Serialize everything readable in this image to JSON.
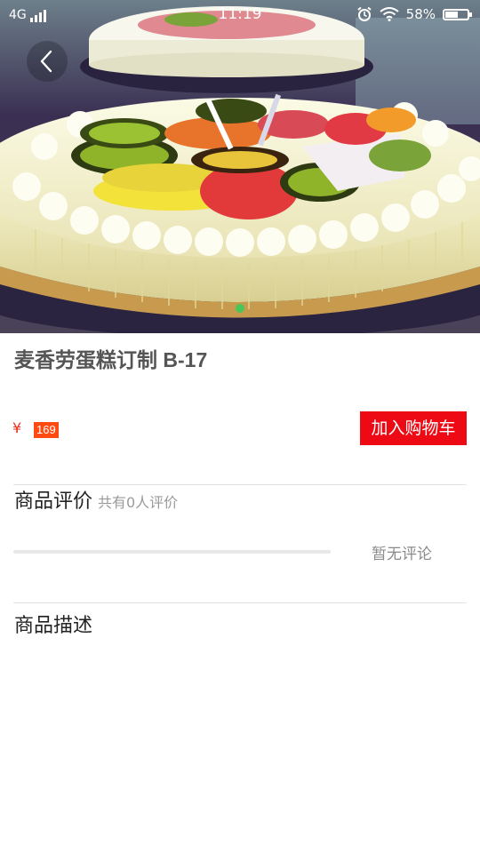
{
  "status_bar": {
    "network": "4G",
    "time": "11:19",
    "battery_percent": "58%",
    "battery_level": 0.58
  },
  "carousel": {
    "image_icon": "cake-photo",
    "active_index": 0,
    "total": 1,
    "dot_color": "#49c65a"
  },
  "product": {
    "title": "麦香劳蛋糕订制 B-17",
    "currency": "¥",
    "price": "169",
    "add_to_cart_label": "加入购物车"
  },
  "reviews": {
    "heading": "商品评价",
    "count_text": "共有0人评价",
    "empty_text": "暂无评论",
    "rating_fraction": 0
  },
  "description": {
    "heading": "商品描述"
  },
  "colors": {
    "accent_red": "#ee0a14",
    "price_tag": "#ff4a12"
  }
}
